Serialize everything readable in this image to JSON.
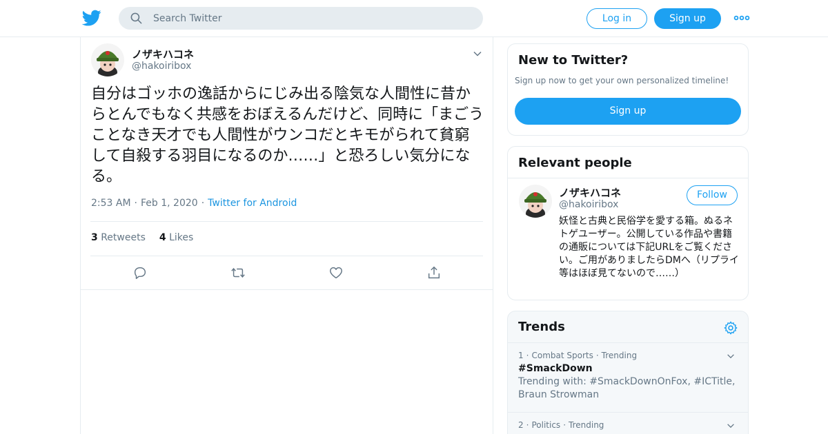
{
  "header": {
    "search_placeholder": "Search Twitter",
    "login_label": "Log in",
    "signup_label": "Sign up",
    "brand_color": "#1da1f2"
  },
  "tweet": {
    "author_name": "ノザキハコネ",
    "author_handle": "@hakoiribox",
    "text": "自分はゴッホの逸話からにじみ出る陰気な人間性に昔からとんでもなく共感をおぼえるんだけど、同時に「まごうことなき天才でも人間性がウンコだとキモがられて貧窮して自殺する羽目になるのか……」と恐ろしい気分になる。",
    "time": "2:53 AM",
    "date": "Feb 1, 2020",
    "source": "Twitter for Android",
    "retweets_count": "3",
    "retweets_label": "Retweets",
    "likes_count": "4",
    "likes_label": "Likes",
    "actions": [
      "reply-icon",
      "retweet-icon",
      "like-icon",
      "share-icon"
    ]
  },
  "sidebar": {
    "new_to_twitter": {
      "title": "New to Twitter?",
      "subtitle": "Sign up now to get your own personalized timeline!",
      "button_label": "Sign up"
    },
    "relevant_people": {
      "title": "Relevant people",
      "name": "ノザキハコネ",
      "handle": "@hakoiribox",
      "follow_label": "Follow",
      "bio": "妖怪と古典と民俗学を愛する箱。ぬるネトゲユーザー。公開している作品や書籍の通販については下記URLをご覧ください。ご用がありましたらDMへ（リプライ等はほぼ見てないので……）"
    },
    "trends": {
      "title": "Trends",
      "items": [
        {
          "rank": "1",
          "category": "Combat Sports",
          "status": "Trending",
          "name": "#SmackDown",
          "description": "Trending with: #SmackDownOnFox, #ICTitle, Braun Strowman"
        },
        {
          "rank": "2",
          "category": "Politics",
          "status": "Trending",
          "name": "",
          "description": ""
        }
      ]
    }
  }
}
